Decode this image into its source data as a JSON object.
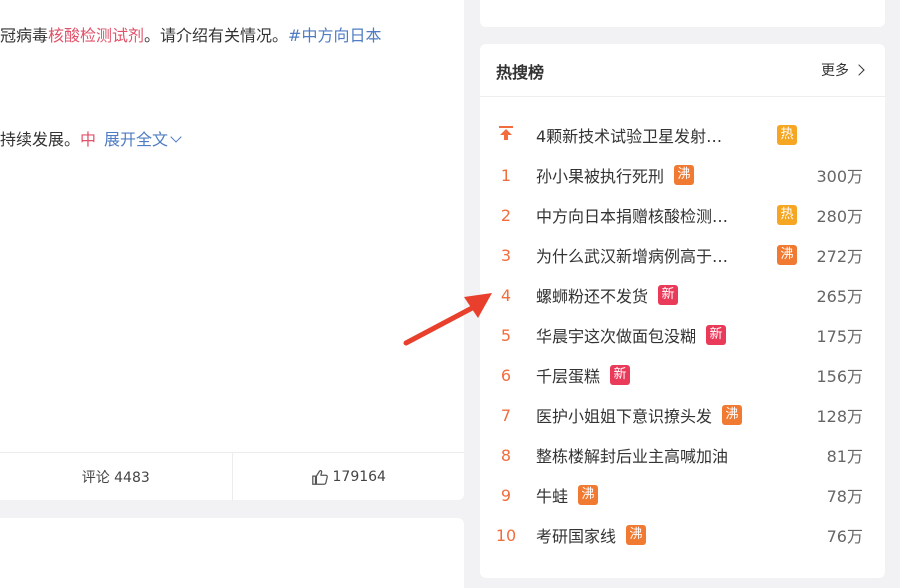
{
  "post": {
    "line1_prefix": "冠病毒",
    "line1_highlight": "核酸检测试剂",
    "line1_middle": "。请介绍有关情况。",
    "line1_tag": "#中方向日本",
    "line2_text": "持续发展。",
    "line2_tag": "中",
    "expand_label": "展开全文"
  },
  "actions": {
    "comment_label": "评论 4483",
    "like_count": "179164"
  },
  "hot_search": {
    "title": "热搜榜",
    "more_label": "更多",
    "items": [
      {
        "rank": "",
        "title": "4颗新技术试验卫星发射…",
        "badge": "热",
        "badge_type": "hot",
        "count": ""
      },
      {
        "rank": "1",
        "title": "孙小果被执行死刑",
        "badge": "沸",
        "badge_type": "boil",
        "count": "300万"
      },
      {
        "rank": "2",
        "title": "中方向日本捐赠核酸检测…",
        "badge": "热",
        "badge_type": "hot",
        "count": "280万"
      },
      {
        "rank": "3",
        "title": "为什么武汉新增病例高于…",
        "badge": "沸",
        "badge_type": "boil",
        "count": "272万"
      },
      {
        "rank": "4",
        "title": "螺蛳粉还不发货",
        "badge": "新",
        "badge_type": "new",
        "count": "265万"
      },
      {
        "rank": "5",
        "title": "华晨宇这次做面包没糊",
        "badge": "新",
        "badge_type": "new",
        "count": "175万"
      },
      {
        "rank": "6",
        "title": "千层蛋糕",
        "badge": "新",
        "badge_type": "new",
        "count": "156万"
      },
      {
        "rank": "7",
        "title": "医护小姐姐下意识撩头发",
        "badge": "沸",
        "badge_type": "boil",
        "count": "128万"
      },
      {
        "rank": "8",
        "title": "整栋楼解封后业主高喊加油",
        "badge": "",
        "badge_type": "",
        "count": "81万"
      },
      {
        "rank": "9",
        "title": "牛蛙",
        "badge": "沸",
        "badge_type": "boil",
        "count": "78万"
      },
      {
        "rank": "10",
        "title": "考研国家线",
        "badge": "沸",
        "badge_type": "boil",
        "count": "76万"
      }
    ]
  },
  "colors": {
    "accent_rank": "#f26d3d",
    "badge_hot": "#f5a623",
    "badge_boil": "#f07a32",
    "badge_new": "#ea3a5a",
    "link_blue": "#4f7cc2",
    "highlight_pink": "#e0526a",
    "arrow_red": "#e8402c"
  },
  "icons": {
    "pin": "pin-top-icon",
    "like": "thumbs-up-icon",
    "expand": "chevron-down-icon",
    "more": "chevron-right-icon",
    "annotation": "red-arrow-icon"
  }
}
